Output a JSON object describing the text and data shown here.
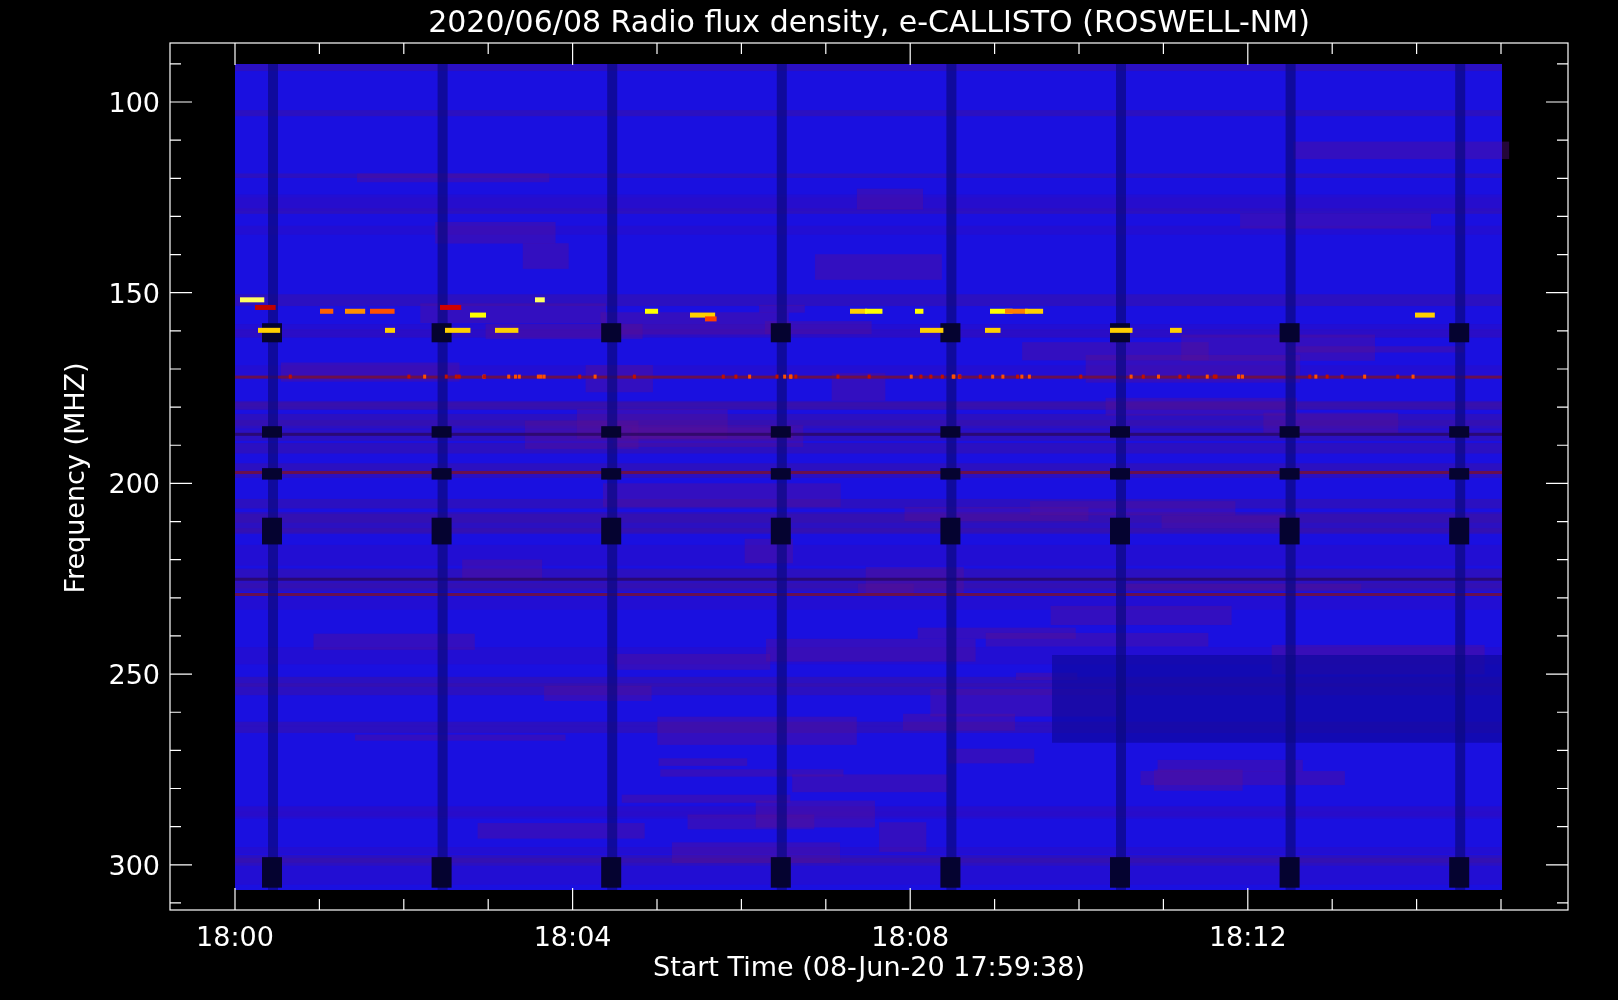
{
  "title": "2020/06/08  Radio flux density, e-CALLISTO (ROSWELL-NM)",
  "y_axis": {
    "label": "Frequency (MHZ)",
    "ticks": [
      "100",
      "150",
      "200",
      "250",
      "300"
    ]
  },
  "x_axis": {
    "label": "Start Time (08-Jun-20 17:59:38)",
    "ticks": [
      "18:00",
      "18:04",
      "18:08",
      "18:12"
    ]
  }
}
